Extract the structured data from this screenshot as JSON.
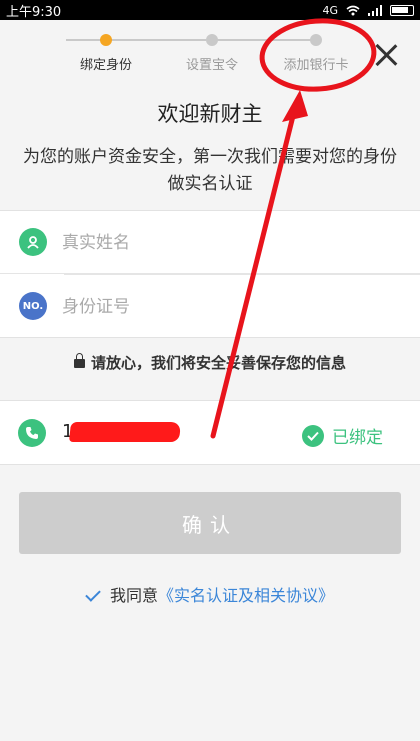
{
  "status_bar": {
    "time": "上午9:30",
    "signal": "4G"
  },
  "steps": [
    {
      "label": "绑定身份",
      "active": true
    },
    {
      "label": "设置宝令",
      "active": false
    },
    {
      "label": "添加银行卡",
      "active": false
    }
  ],
  "close_icon": "close-icon",
  "welcome": {
    "title": "欢迎新财主",
    "description": "为您的账户资金安全，第一次我们需要对您的身份做实名认证"
  },
  "form": {
    "name_placeholder": "真实姓名",
    "id_placeholder": "身份证号",
    "id_icon_text": "NO."
  },
  "secure_note": "请放心，我们将安全妥善保存您的信息",
  "phone": {
    "number_visible": "1",
    "bound_text": "已绑定"
  },
  "confirm_label": "确认",
  "agreement": {
    "prefix": "我同意",
    "link": "《实名认证及相关协议》"
  },
  "colors": {
    "accent_orange": "#f5a623",
    "green": "#3cc27f",
    "blue": "#4a74c9",
    "link_blue": "#3b86d8",
    "annotation_red": "#e8141c"
  }
}
